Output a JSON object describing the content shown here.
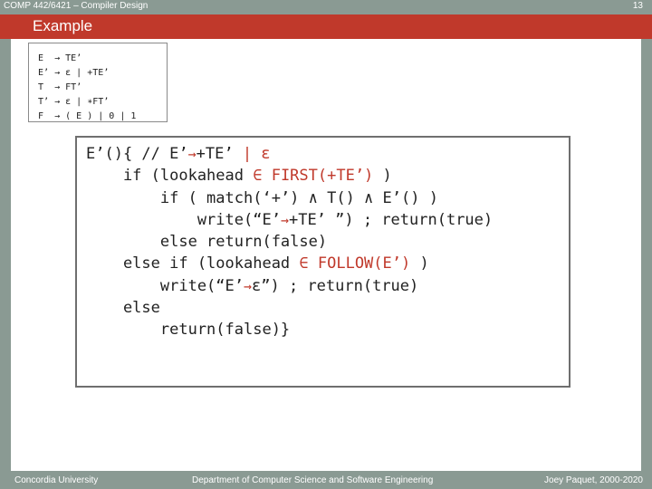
{
  "header": {
    "course": "COMP 442/6421 – Compiler Design",
    "page_number": "13"
  },
  "title": "Example",
  "grammar": [
    [
      "E",
      "→",
      "TE’"
    ],
    [
      "E’",
      "→",
      "ε | +TE’"
    ],
    [
      "T",
      "→",
      "FT’"
    ],
    [
      "T’",
      "→",
      "ε | ∗FT’"
    ],
    [
      "F",
      "→",
      "( E ) | 0 | 1"
    ]
  ],
  "code": {
    "l1a": "E’(){ // E’",
    "l1b": "+TE’ ",
    "l1c": "| ε",
    "l2a": "    if (lookahead ",
    "l2b": "∈ FIRST(+TE’) ",
    "l2c": ")",
    "l3": "        if ( match(‘+’) ∧ T() ∧ E’() )",
    "l4a": "            write(“E’",
    "l4b": "+TE’ ”) ; return(true)",
    "l5": "        else return(false)",
    "l6a": "    else if (lookahead ",
    "l6b": "∈ FOLLOW(E’) ",
    "l6c": ")",
    "l7a": "        write(“E’",
    "l7b": "ε”) ; return(true)",
    "l8": "    else",
    "l9": "        return(false)}",
    "arrow": "→"
  },
  "footer": {
    "left": "Concordia University",
    "center": "Department of Computer Science and Software Engineering",
    "right": "Joey Paquet, 2000-2020"
  },
  "colors": {
    "accent": "#c0392b",
    "background": "#8a9a93",
    "panel": "#ffffff"
  }
}
